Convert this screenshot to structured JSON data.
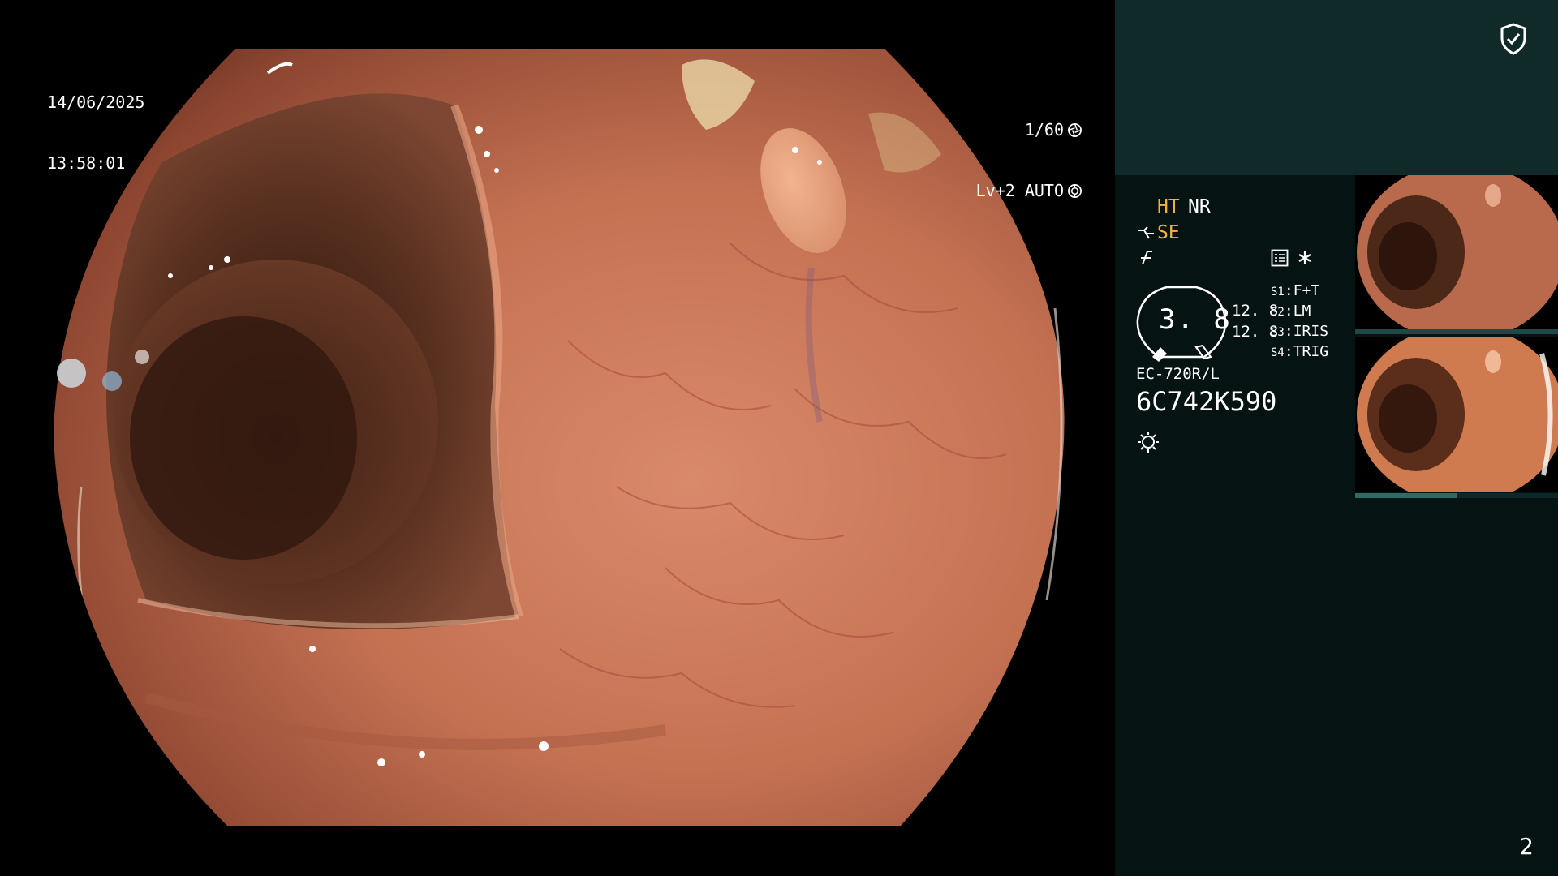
{
  "overlay": {
    "date": "14/06/2025",
    "time": "13:58:01",
    "shutter": "1/60",
    "light_level": "Lv+2 AUTO"
  },
  "panel": {
    "modes": {
      "ht": "HT",
      "nr": "NR",
      "se": "SE"
    },
    "gauge_value": "3. 8",
    "value_a": "12. 8",
    "value_b": "12. 8",
    "switches": [
      {
        "key": "S1",
        "label": "F+T"
      },
      {
        "key": "S2",
        "label": "LM"
      },
      {
        "key": "S3",
        "label": "IRIS"
      },
      {
        "key": "S4",
        "label": "TRIG"
      }
    ],
    "scope_model": "EC-720R/L",
    "scope_serial": "6C742K590",
    "page_number": "2",
    "thumb2_progress": 0.5
  },
  "colors": {
    "accent_orange": "#f3b43a",
    "panel_dark": "#051413",
    "panel_top": "#0f2a28"
  },
  "icons": [
    "shield-check-icon",
    "aperture-icon",
    "iris-icon",
    "se-icon",
    "freeze-icon",
    "list-icon",
    "star-icon",
    "light-icon"
  ]
}
